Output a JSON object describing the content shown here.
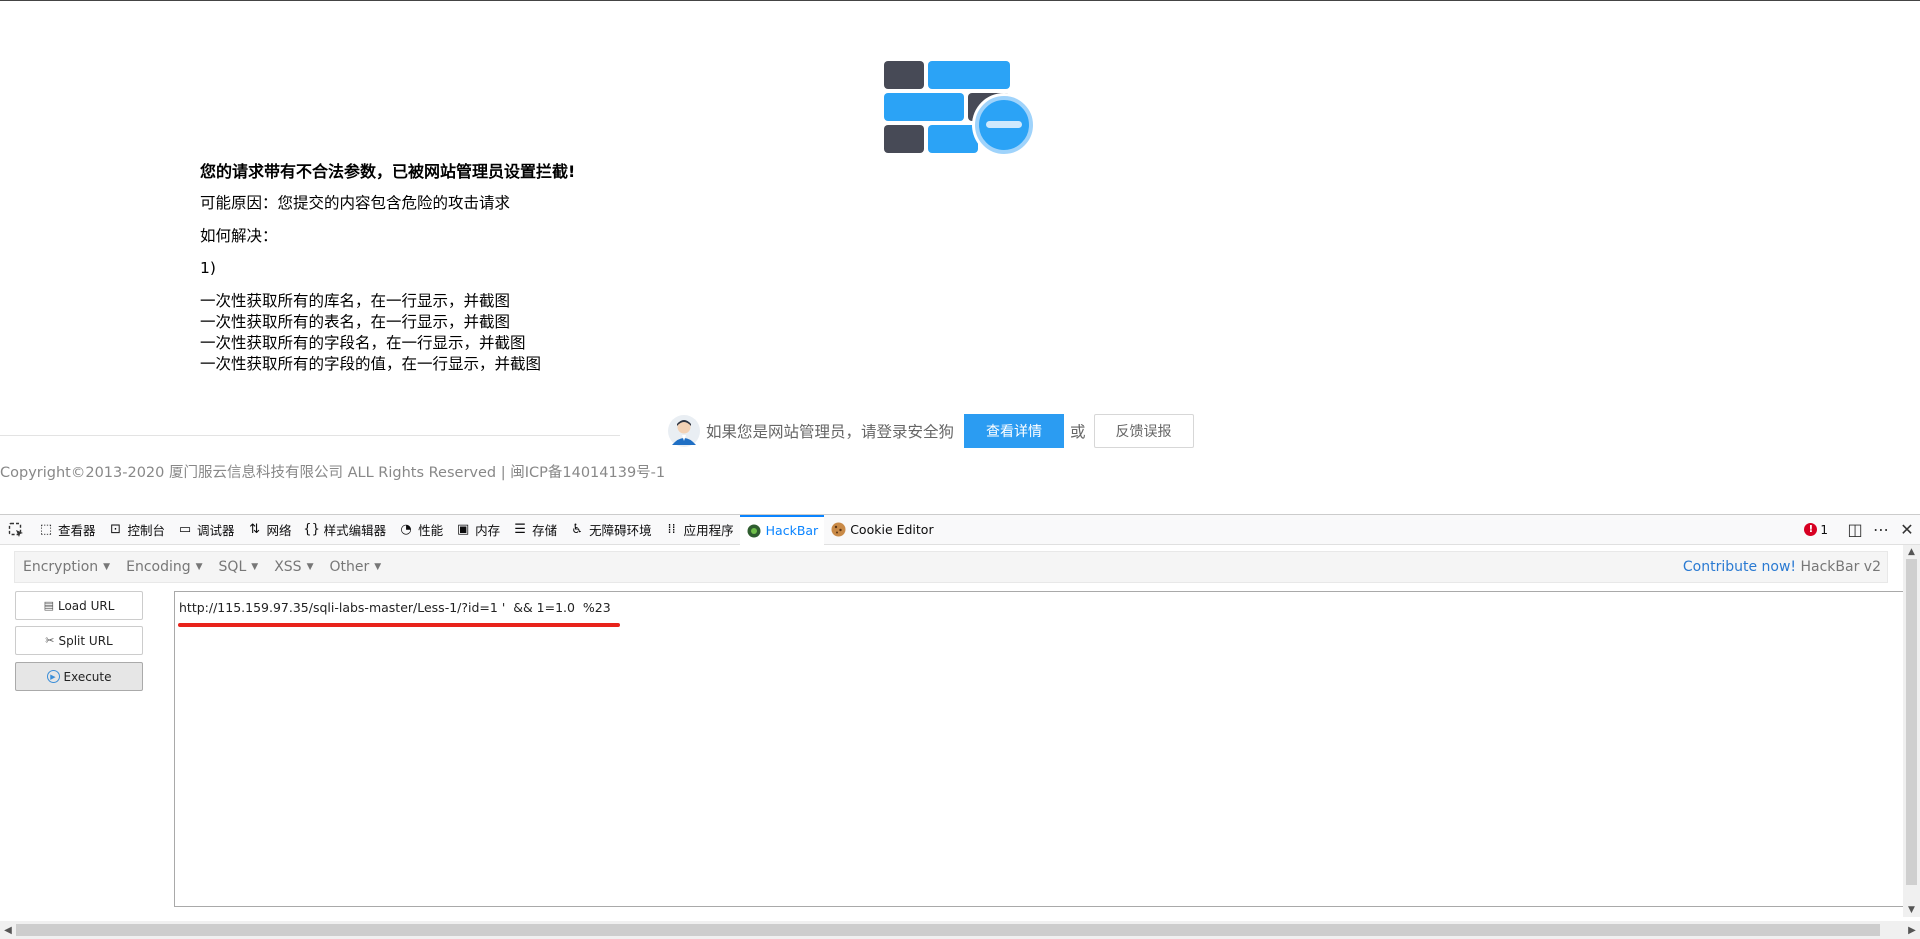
{
  "page": {
    "heading": "您的请求带有不合法参数，已被网站管理员设置拦截!",
    "reason": "可能原因：您提交的内容包含危险的攻击请求",
    "how_to": "如何解决：",
    "step": "1)",
    "tasks": [
      "一次性获取所有的库名，在一行显示，并截图",
      "一次性获取所有的表名，在一行显示，并截图",
      "一次性获取所有的字段名，在一行显示，并截图",
      "一次性获取所有的字段的值，在一行显示，并截图"
    ],
    "admin_prompt": "如果您是网站管理员，请登录安全狗",
    "details_button": "查看详情",
    "or_text": "或",
    "feedback_button": "反馈误报",
    "copyright": "Copyright©2013-2020 厦门服云信息科技有限公司 ALL Rights Reserved | 闽ICP备14014139号-1"
  },
  "devtools": {
    "tabs": [
      {
        "label": "查看器",
        "icon": "inspector-icon"
      },
      {
        "label": "控制台",
        "icon": "console-icon"
      },
      {
        "label": "调试器",
        "icon": "debugger-icon"
      },
      {
        "label": "网络",
        "icon": "network-icon"
      },
      {
        "label": "样式编辑器",
        "icon": "style-editor-icon"
      },
      {
        "label": "性能",
        "icon": "performance-icon"
      },
      {
        "label": "内存",
        "icon": "memory-icon"
      },
      {
        "label": "存储",
        "icon": "storage-icon"
      },
      {
        "label": "无障碍环境",
        "icon": "accessibility-icon"
      },
      {
        "label": "应用程序",
        "icon": "application-icon"
      },
      {
        "label": "HackBar",
        "icon": "hackbar-icon",
        "active": true
      },
      {
        "label": "Cookie Editor",
        "icon": "cookie-icon"
      }
    ],
    "error_count": "1",
    "accent": "#0a84ff",
    "error_color": "#d70022"
  },
  "hackbar": {
    "menu": [
      "Encryption",
      "Encoding",
      "SQL",
      "XSS",
      "Other"
    ],
    "contribute_link": "Contribute now!",
    "version": "HackBar v2",
    "load_url": "Load URL",
    "split_url": "Split URL",
    "execute": "Execute",
    "url_value": "http://115.159.97.35/sqli-labs-master/Less-1/?id=1 '  && 1=1.0  %23",
    "highlight_color": "#e8231b"
  }
}
